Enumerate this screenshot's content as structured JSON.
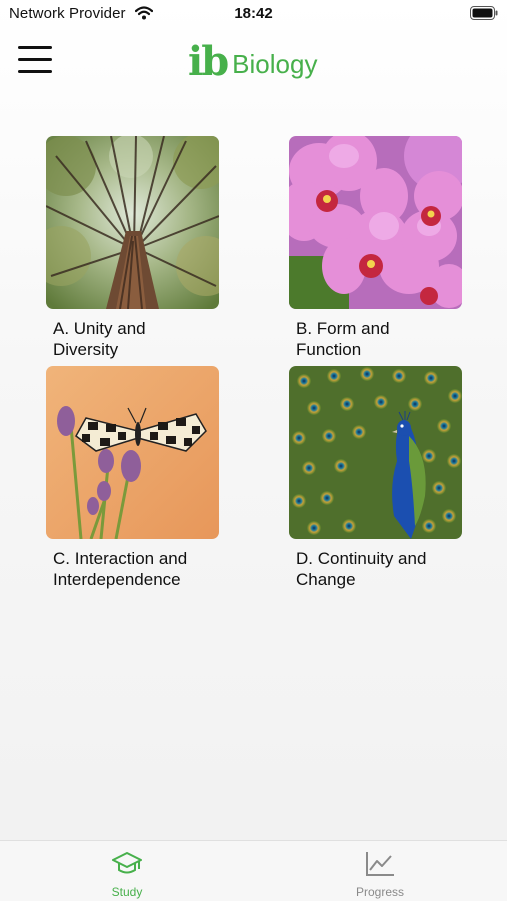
{
  "status_bar": {
    "carrier": "Network Provider",
    "time": "18:42",
    "icons": [
      "wifi-icon",
      "battery-icon"
    ]
  },
  "header": {
    "logo_mark": "ib",
    "logo_text": "Biology",
    "menu_icon": "hamburger-menu-icon",
    "brand_color": "#47b04b"
  },
  "topics": [
    {
      "line1": "A. Unity and",
      "line2": "Diversity",
      "image": "tree-canopy-photo"
    },
    {
      "line1": "B. Form and",
      "line2": "Function",
      "image": "pink-orchid-photo"
    },
    {
      "line1": "C. Interaction and",
      "line2": "Interdependence",
      "image": "butterfly-on-thistle-photo"
    },
    {
      "line1": "D. Continuity and",
      "line2": "Change",
      "image": "peacock-photo"
    }
  ],
  "tabbar": {
    "tabs": [
      {
        "label": "Study",
        "icon": "graduation-cap-icon",
        "active": true,
        "color": "#47b04b"
      },
      {
        "label": "Progress",
        "icon": "line-chart-icon",
        "active": false,
        "color": "#8a8a8a"
      }
    ]
  }
}
